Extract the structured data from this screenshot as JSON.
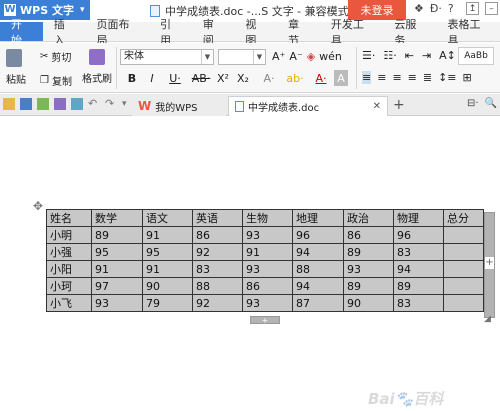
{
  "titlebar": {
    "app_label": "WPS 文字",
    "doc_title": "中学成绩表.doc -...S 文字 - 兼容模式",
    "login_label": "未登录",
    "help_label": "?"
  },
  "ribbon_tabs": [
    "开始",
    "插入",
    "页面布局",
    "引用",
    "审阅",
    "视图",
    "章节",
    "开发工具",
    "云服务",
    "表格工具"
  ],
  "ribbon": {
    "paste_label": "粘贴",
    "cut_label": "剪切",
    "copy_label": "复制",
    "format_painter_label": "格式刷",
    "font_name": "宋体",
    "font_size": ""
  },
  "tabs": {
    "wps_tab_label": "我的WPS",
    "doc_tab_label": "中学成绩表.doc",
    "new_tab": "+"
  },
  "table": {
    "headers": [
      "姓名",
      "数学",
      "语文",
      "英语",
      "生物",
      "地理",
      "政治",
      "物理",
      "总分"
    ],
    "rows": [
      [
        "小明",
        "89",
        "91",
        "86",
        "93",
        "96",
        "86",
        "96",
        ""
      ],
      [
        "小强",
        "95",
        "95",
        "92",
        "91",
        "94",
        "89",
        "83",
        ""
      ],
      [
        "小阳",
        "91",
        "91",
        "83",
        "93",
        "88",
        "93",
        "94",
        ""
      ],
      [
        "小珂",
        "97",
        "90",
        "88",
        "86",
        "94",
        "89",
        "89",
        ""
      ],
      [
        "小飞",
        "93",
        "79",
        "92",
        "93",
        "87",
        "90",
        "83",
        ""
      ]
    ]
  },
  "watermark": "Bai🐾百科"
}
